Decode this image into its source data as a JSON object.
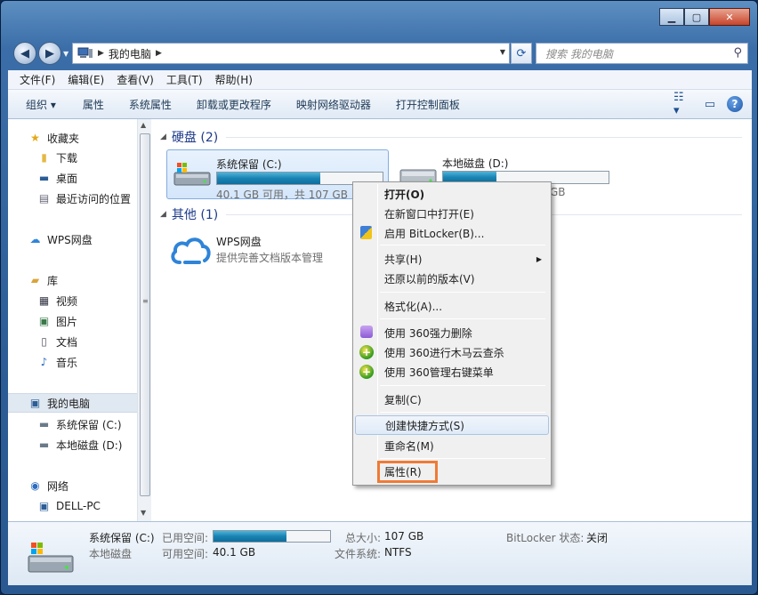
{
  "window": {
    "caption_buttons": [
      "minimize",
      "maximize",
      "close"
    ]
  },
  "address": {
    "path": "我的电脑",
    "search_placeholder": "搜索 我的电脑"
  },
  "menubar": [
    "文件(F)",
    "编辑(E)",
    "查看(V)",
    "工具(T)",
    "帮助(H)"
  ],
  "toolbar": {
    "organize": "组织 ▾",
    "items": [
      "属性",
      "系统属性",
      "卸载或更改程序",
      "映射网络驱动器",
      "打开控制面板"
    ]
  },
  "sidebar": {
    "favorites": "收藏夹",
    "downloads": "下载",
    "desktop": "桌面",
    "recent": "最近访问的位置",
    "wps": "WPS网盘",
    "library": "库",
    "videos": "视频",
    "pictures": "图片",
    "documents": "文档",
    "music": "音乐",
    "computer": "我的电脑",
    "drive_c": "系统保留 (C:)",
    "drive_d": "本地磁盘 (D:)",
    "network": "网络",
    "dell": "DELL-PC"
  },
  "content": {
    "hdd_group": "硬盘 (2)",
    "other_group": "其他 (1)",
    "drive_c": {
      "name": "系统保留 (C:)",
      "free": "40.1 GB 可用，共 107 GB",
      "used_fraction": 0.625
    },
    "drive_d": {
      "name": "本地磁盘 (D:)",
      "free_tail": "GB",
      "used_fraction": 0.32
    },
    "wps": {
      "name": "WPS网盘",
      "desc": "提供完善文档版本管理"
    }
  },
  "context_menu": {
    "open": "打开(O)",
    "open_new": "在新窗口中打开(E)",
    "bitlocker": "启用 BitLocker(B)...",
    "share": "共享(H)",
    "restore": "还原以前的版本(V)",
    "format": "格式化(A)...",
    "del360": "使用 360强力删除",
    "trojan360": "使用 360进行木马云查杀",
    "menu360": "使用 360管理右键菜单",
    "copy": "复制(C)",
    "shortcut": "创建快捷方式(S)",
    "rename": "重命名(M)",
    "properties": "属性(R)"
  },
  "details": {
    "name": "系统保留 (C:)",
    "type": "本地磁盘",
    "used_label": "已用空间:",
    "free_label": "可用空间:",
    "free_value": "40.1 GB",
    "total_label": "总大小:",
    "total_value": "107 GB",
    "fs_label": "文件系统:",
    "fs_value": "NTFS",
    "bitlocker_label": "BitLocker 状态:",
    "bitlocker_value": "关闭",
    "used_fraction": 0.625
  },
  "colors": {
    "accent": "#1e3a8a",
    "highlight_box": "#f07a36",
    "bar_fill": "#1a83b3"
  }
}
